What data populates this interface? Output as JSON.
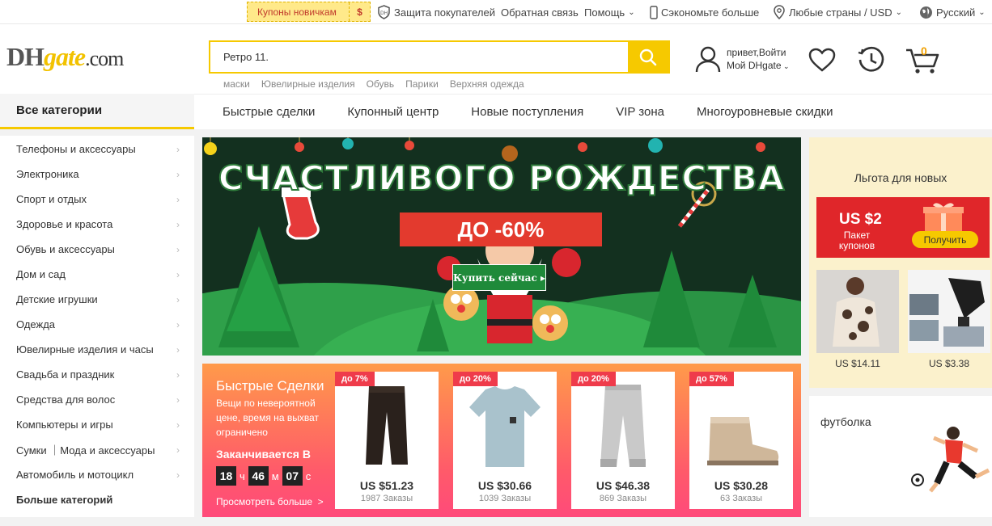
{
  "topbar": {
    "coupon_label": "Купоны новичкам",
    "coupon_symbol": "$",
    "protection": "Защита покупателей",
    "feedback": "Обратная связь",
    "help": "Помощь",
    "save_more": "Сэкономьте больше",
    "region": "Любые страны / USD",
    "language": "Русский"
  },
  "logo": {
    "part1": "DH",
    "part2": "gate",
    "part3": ".com"
  },
  "search": {
    "value": "Ретро 11.",
    "hotwords": [
      "маски",
      "Ювелирные изделия",
      "Обувь",
      "Парики",
      "Верхняя одежда"
    ]
  },
  "account": {
    "line1": "привет,Войти",
    "line2": "Мой DHgate",
    "cart_count": "0"
  },
  "nav": {
    "all_categories": "Все категории",
    "items": [
      "Быстрые сделки",
      "Купонный центр",
      "Новые поступления",
      "VIP зона",
      "Многоуровневые скидки"
    ]
  },
  "sidebar": {
    "items": [
      "Телефоны и аксессуары",
      "Электроника",
      "Спорт и отдых",
      "Здоровье и красота",
      "Обувь и аксессуары",
      "Дом и сад",
      "Детские игрушки",
      "Одежда",
      "Ювелирные изделия и часы",
      "Свадьба и праздник",
      "Средства для волос",
      "Компьютеры и игры",
      "Сумки ｜Мода и аксессуары",
      "Автомобиль и мотоцикл"
    ],
    "more": "Больше категорий"
  },
  "banner": {
    "title": "СЧАСТЛИВОГО РОЖДЕСТВА",
    "discount": "ДО -60%",
    "cta": "Купить сейчас ▸"
  },
  "newuser": {
    "title": "Льгота для новых",
    "coupon_amount": "US $2",
    "coupon_line1": "Пакет",
    "coupon_line2": "купонов",
    "get": "Получить",
    "products": [
      {
        "price": "US $14.11"
      },
      {
        "price": "US $3.38"
      }
    ]
  },
  "deals": {
    "title": "Быстрые Сделки",
    "desc": "Вещи по невероятной цене, время на выхват ограничено",
    "ends": "Заканчивается В",
    "hours": "18",
    "h_unit": "ч",
    "minutes": "46",
    "m_unit": "м",
    "seconds": "07",
    "s_unit": "с",
    "view_more": "Просмотреть больше  >",
    "cards": [
      {
        "badge": "до 7%",
        "price": "US $51.23",
        "orders": "1987 Заказы"
      },
      {
        "badge": "до 20%",
        "price": "US $30.66",
        "orders": "1039 Заказы"
      },
      {
        "badge": "до 20%",
        "price": "US $46.38",
        "orders": "869 Заказы"
      },
      {
        "badge": "до 57%",
        "price": "US $30.28",
        "orders": "63 Заказы"
      }
    ]
  },
  "football": {
    "title": "футболка"
  },
  "colors": {
    "accent": "#f6c900",
    "deal_red": "#ef3b4b",
    "banner_green": "#13301f"
  }
}
